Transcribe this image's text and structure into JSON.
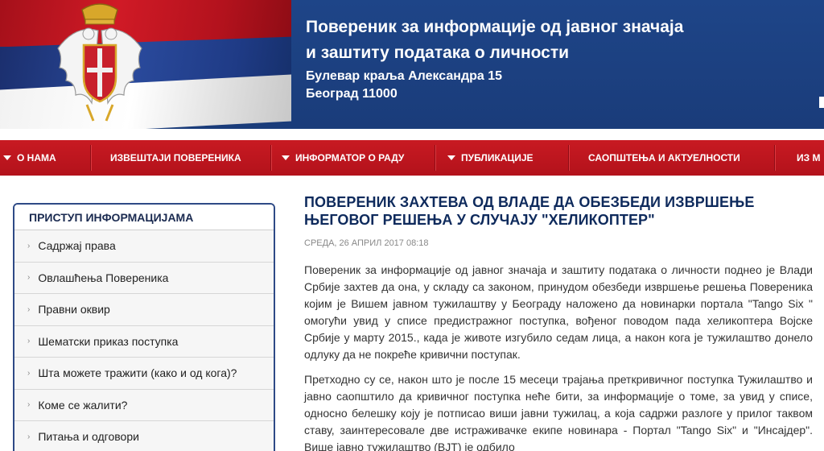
{
  "header": {
    "title_line1": "Повереник за информације од јавног значаја",
    "title_line2": "и заштиту података о личности",
    "address_line1": "Булевар краља Александра 15",
    "address_line2": "Београд 11000"
  },
  "nav": {
    "items": [
      {
        "label": "О НАМА",
        "has_dropdown": true
      },
      {
        "label": "ИЗВЕШТАЈИ ПОВЕРЕНИКА",
        "has_dropdown": false
      },
      {
        "label": "ИНФОРМАТОР О РАДУ",
        "has_dropdown": true
      },
      {
        "label": "ПУБЛИКАЦИЈЕ",
        "has_dropdown": true
      },
      {
        "label": "САОПШТЕЊА И АКТУЕЛНОСТИ",
        "has_dropdown": false
      },
      {
        "label": "ИЗ М",
        "has_dropdown": false
      }
    ]
  },
  "sidebar": {
    "title": "ПРИСТУП ИНФОРМАЦИЈАМА",
    "items": [
      "Садржај права",
      "Овлашћења Повереника",
      "Правни оквир",
      "Шематски приказ поступка",
      "Шта можете тражити (како и од кога)?",
      "Коме се жалити?",
      "Питања и одговори"
    ]
  },
  "article": {
    "title": "ПОВЕРЕНИК ЗАХТЕВА ОД ВЛАДЕ ДА ОБЕЗБЕДИ ИЗВРШЕЊЕ ЊЕГОВОГ РЕШЕЊА У СЛУЧАЈУ \"ХЕЛИКОПТЕР\"",
    "date": "СРЕДА, 26 АПРИЛ 2017 08:18",
    "paragraph1": "Повереник за информације од јавног значаја и заштиту података о личности поднео је Влади Србије захтев да она, у складу са законом, принудом обезбеди извршење решења Повереника којим је Вишем јавном тужилаштву у Београду наложено да новинарки портала \"Tango Six \" омогући увид у списе предистражног поступка, вођеног поводом пада хеликоптера Војске Србије у марту 2015., када је животе изгубило седам лица, а након кога је тужилаштво донело одлуку да не покреће кривични поступак.",
    "paragraph2": "Претходно су се, након што је после 15 месеци трајања преткривичног поступка Тужилаштво и јавно саопштило да кривичног поступка неће бити, за информације о томе, за увид у списе, односно белешку коју је потписао виши јавни тужилац, а која садржи разлоге у прилог таквом ставу, заинтересовале две истраживачке екипе новинара - Портал \"Tango Six\" и \"Инсајдер\". Више јавно тужилаштво (ВЈТ) је одбило"
  },
  "colors": {
    "header_blue": "#1a3c7a",
    "nav_red": "#c81a22",
    "title_blue": "#0e2a5c"
  }
}
